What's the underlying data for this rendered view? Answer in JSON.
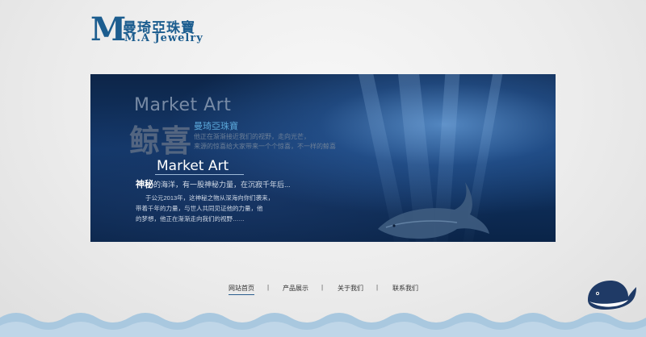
{
  "logo": {
    "letter": "M",
    "chinese": "曼琦亞珠寶",
    "english": "M.A Jewelry"
  },
  "banner": {
    "title1": "Market Art",
    "big_chars": "鲸喜",
    "subtitle": "曼琦亞珠寶",
    "small_lines": [
      "他正在渐渐接近我们的视野，走向光芒，",
      "来源的惊喜给大家带来一个个惊喜，不一样的鲸喜"
    ],
    "title2": "Market Art",
    "slogan_highlight": "神秘",
    "slogan_rest": "的海洋，有一股神秘力量，在沉寂千年后...",
    "body_lines": [
      "于公元2013年，这神秘之物从深海向你们袭来，",
      "带着千年的力量，与世人共同见证他的力量，他",
      "的梦想，他正在渐渐走向我们的视野……"
    ]
  },
  "nav": {
    "items": [
      "网站首页",
      "产品展示",
      "关于我们",
      "联系我们"
    ],
    "active_index": 0,
    "separator": "|"
  },
  "colors": {
    "brand": "#1c5d8f",
    "wave": "#a9c8df",
    "whale": "#1f3a66"
  }
}
